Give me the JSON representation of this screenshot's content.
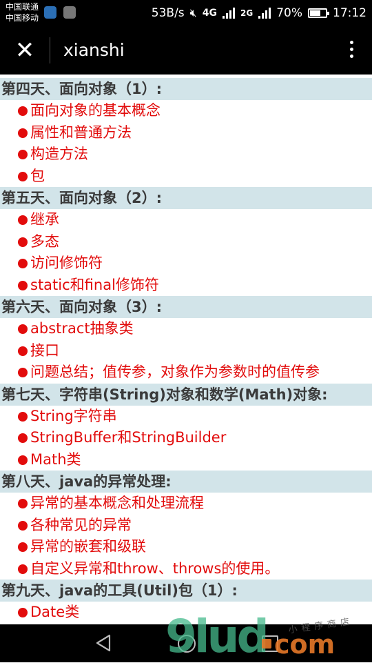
{
  "status_bar": {
    "carrier_1": "中国联通",
    "carrier_2": "中国移动",
    "net_speed": "53B/s",
    "net_4g": "4G",
    "net_2g": "2G",
    "battery": "70%",
    "battery_level": 0.7,
    "time": "17:12"
  },
  "app_bar": {
    "close_icon": "✕",
    "title": "xianshi",
    "more_icon": "more-vertical-icon"
  },
  "sections": [
    {
      "title": "第四天、面向对象（1）:",
      "items": [
        "面向对象的基本概念",
        "属性和普通方法",
        "构造方法",
        "包"
      ]
    },
    {
      "title": "第五天、面向对象（2）:",
      "items": [
        "继承",
        "多态",
        "访问修饰符",
        "static和final修饰符"
      ]
    },
    {
      "title": "第六天、面向对象（3）:",
      "items": [
        "abstract抽象类",
        "接口",
        "问题总结；值传参，对象作为参数时的值传参"
      ]
    },
    {
      "title": "第七天、字符串(String)对象和数学(Math)对象:",
      "items": [
        "String字符串",
        "StringBuffer和StringBuilder",
        "Math类"
      ]
    },
    {
      "title": "第八天、java的异常处理:",
      "items": [
        "异常的基本概念和处理流程",
        "各种常见的异常",
        "异常的嵌套和级联",
        "自定义异常和throw、throws的使用。"
      ]
    },
    {
      "title": "第九天、java的工具(Util)包（1）:",
      "items": [
        "Date类"
      ]
    }
  ],
  "watermark": {
    "main": "9lud",
    "tld": "com",
    "small": "小程序商店"
  },
  "colors": {
    "heading_bg": "#d2e4e9",
    "heading_text": "#3a3a3a",
    "item_text": "#e20c0c",
    "bar_bg": "#000000"
  }
}
